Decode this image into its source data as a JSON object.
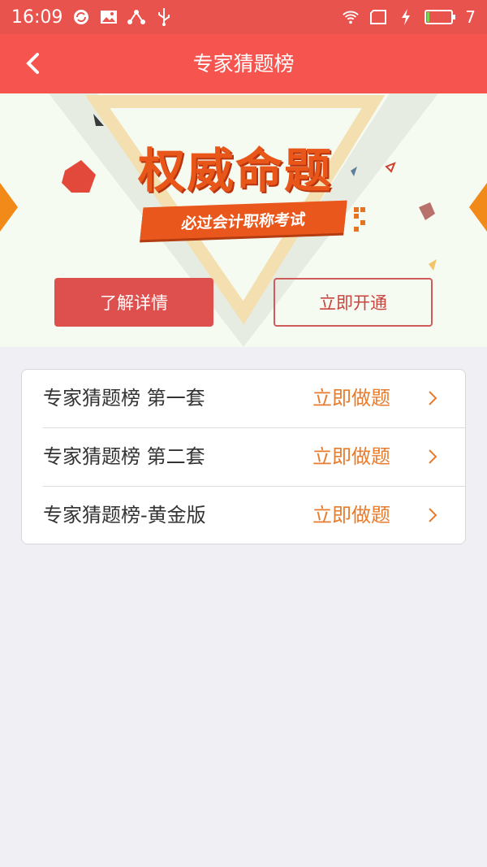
{
  "status_bar": {
    "time": "16:09",
    "battery_level": "7",
    "left_icons": [
      "sync-icon",
      "image-icon",
      "share-icon",
      "usb-icon"
    ],
    "right_icons": [
      "wifi-icon",
      "sim-icon",
      "charging-icon",
      "battery-icon"
    ]
  },
  "nav": {
    "title": "专家猜题榜",
    "back_icon": "chevron-left-icon"
  },
  "banner": {
    "heading": "权威命题",
    "subtitle": "必过会计职称考试",
    "detail_button": "了解详情",
    "open_button": "立即开通"
  },
  "list": {
    "items": [
      {
        "title": "专家猜题榜 第一套",
        "action": "立即做题"
      },
      {
        "title": "专家猜题榜 第二套",
        "action": "立即做题"
      },
      {
        "title": "专家猜题榜-黄金版",
        "action": "立即做题"
      }
    ]
  },
  "colors": {
    "nav_bg": "#f6544f",
    "status_bg": "#e8534d",
    "action_text": "#e97b2c",
    "accent_orange": "#e8561a"
  }
}
